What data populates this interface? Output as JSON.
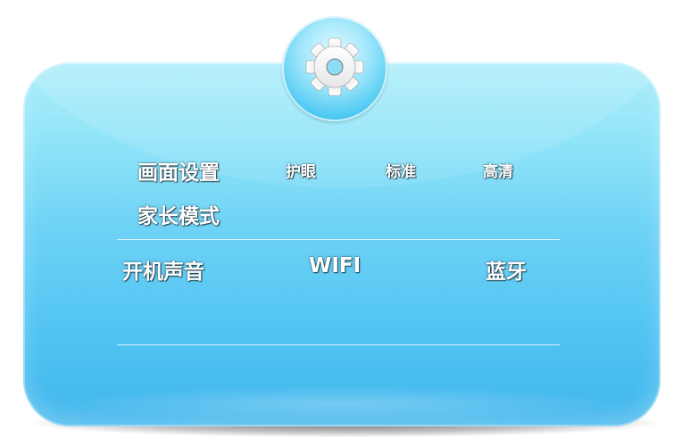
{
  "settings_panel": {
    "icon": "gear-icon",
    "picture": {
      "label": "画面设置",
      "options": [
        "护眼",
        "标准",
        "高清"
      ]
    },
    "parental_mode_label": "家长模式",
    "toggles": {
      "boot_sound_label": "开机声音",
      "wifi_label": "WIFI",
      "bluetooth_label": "蓝牙"
    }
  },
  "colors": {
    "panel_top": "#aeeefb",
    "panel_bottom": "#3fb5ec",
    "text": "#ffffff"
  }
}
